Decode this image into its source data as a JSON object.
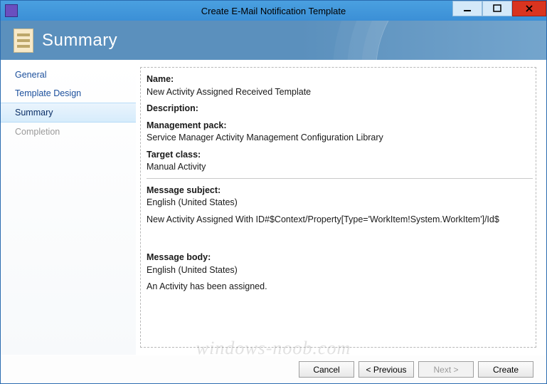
{
  "window": {
    "title": "Create E-Mail Notification Template"
  },
  "banner": {
    "heading": "Summary"
  },
  "sidebar": {
    "items": [
      {
        "label": "General",
        "state": "normal"
      },
      {
        "label": "Template Design",
        "state": "normal"
      },
      {
        "label": "Summary",
        "state": "selected"
      },
      {
        "label": "Completion",
        "state": "disabled"
      }
    ]
  },
  "summary": {
    "name_label": "Name:",
    "name_value": "New Activity Assigned Received Template",
    "description_label": "Description:",
    "description_value": "",
    "mgmtpack_label": "Management pack:",
    "mgmtpack_value": "Service Manager Activity Management Configuration Library",
    "target_label": "Target class:",
    "target_value": "Manual Activity",
    "subject_label": "Message subject:",
    "subject_lang": "English (United States)",
    "subject_value": "New Activity Assigned With ID#$Context/Property[Type='WorkItem!System.WorkItem']/Id$",
    "body_label": "Message body:",
    "body_lang": "English (United States)",
    "body_value": "An Activity has been assigned."
  },
  "footer": {
    "cancel": "Cancel",
    "previous": "< Previous",
    "next": "Next >",
    "create": "Create"
  },
  "watermark": "windows-noob.com"
}
